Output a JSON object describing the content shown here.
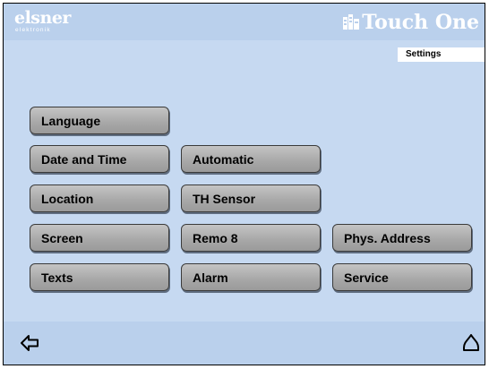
{
  "header": {
    "brand_name": "elsner",
    "brand_sub": "elektronik",
    "product_name": "Touch One",
    "colors": {
      "header_bg": "#bad0ec",
      "panel_bg": "#c6d9f1",
      "button_bg": "#a9a9a9"
    }
  },
  "page_tag": "Settings",
  "buttons": {
    "language": "Language",
    "date_time": "Date and Time",
    "automatic": "Automatic",
    "location": "Location",
    "th_sensor": "TH Sensor",
    "screen": "Screen",
    "remo8": "Remo 8",
    "phys_address": "Phys. Address",
    "texts": "Texts",
    "alarm": "Alarm",
    "service": "Service"
  },
  "footer": {
    "back_icon": "arrow-left-icon",
    "home_icon": "home-icon"
  }
}
